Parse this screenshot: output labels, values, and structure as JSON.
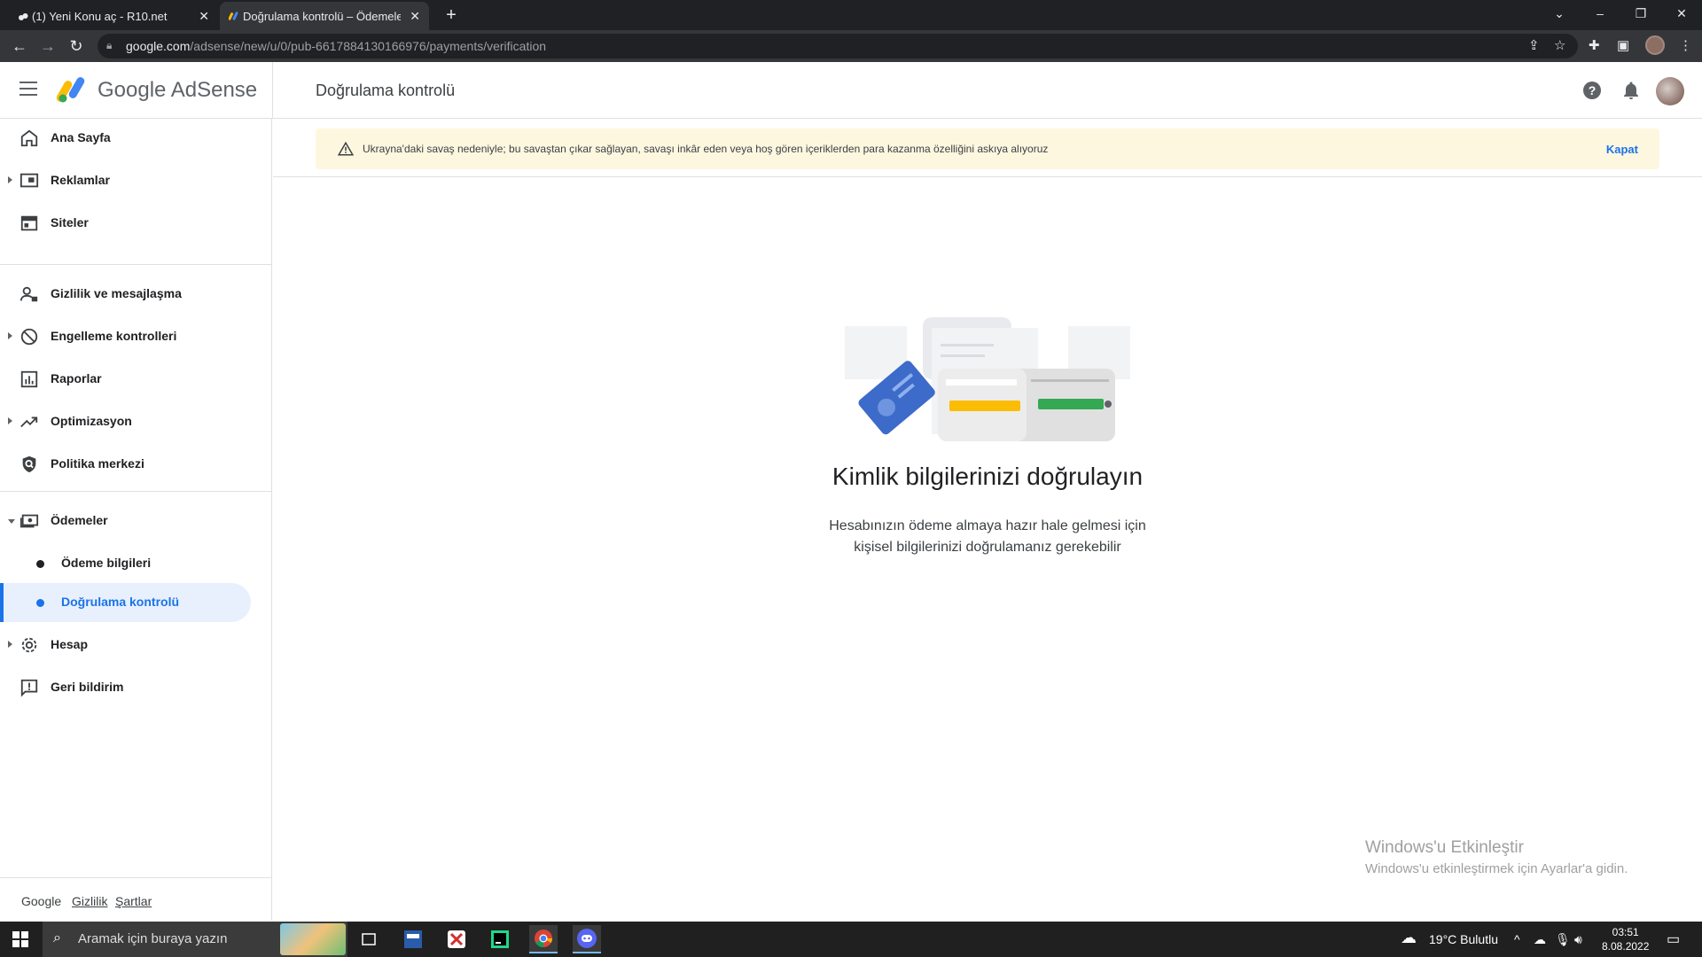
{
  "browser": {
    "tabs": [
      {
        "label": "(1) Yeni Konu aç - R10.net",
        "active": false
      },
      {
        "label": "Doğrulama kontrolü – Ödemeler",
        "active": true
      }
    ],
    "url_host": "google.com",
    "url_path": "/adsense/new/u/0/pub-6617884130166976/payments/verification"
  },
  "header": {
    "logo_text": "Google AdSense",
    "page_title": "Doğrulama kontrolü"
  },
  "sidebar": {
    "items": [
      {
        "label": "Ana Sayfa",
        "icon": "home-icon"
      },
      {
        "label": "Reklamlar",
        "icon": "ads-icon"
      },
      {
        "label": "Siteler",
        "icon": "sites-icon"
      },
      {
        "label": "Gizlilik ve mesajlaşma",
        "icon": "privacy-icon"
      },
      {
        "label": "Engelleme kontrolleri",
        "icon": "block-icon"
      },
      {
        "label": "Raporlar",
        "icon": "reports-icon"
      },
      {
        "label": "Optimizasyon",
        "icon": "optimization-icon"
      },
      {
        "label": "Politika merkezi",
        "icon": "policy-icon"
      },
      {
        "label": "Ödemeler",
        "icon": "payments-icon"
      },
      {
        "label": "Ödeme bilgileri"
      },
      {
        "label": "Doğrulama kontrolü"
      },
      {
        "label": "Hesap",
        "icon": "gear-icon"
      },
      {
        "label": "Geri bildirim",
        "icon": "feedback-icon"
      }
    ],
    "footer": {
      "google": "Google",
      "privacy": "Gizlilik",
      "terms": "Şartlar"
    }
  },
  "banner": {
    "text": "Ukrayna'daki savaş nedeniyle; bu savaştan çıkar sağlayan, savaşı inkâr eden veya hoş gören içeriklerden para kazanma özelliğini askıya alıyoruz",
    "close_label": "Kapat"
  },
  "main": {
    "heading": "Kimlik bilgilerinizi doğrulayın",
    "desc_line1": "Hesabınızın ödeme almaya hazır hale gelmesi için",
    "desc_line2": "kişisel bilgilerinizi doğrulamanız gerekebilir"
  },
  "watermark": {
    "title": "Windows'u Etkinleştir",
    "subtitle": "Windows'u etkinleştirmek için Ayarlar'a gidin."
  },
  "taskbar": {
    "search_placeholder": "Aramak için buraya yazın",
    "weather": "19°C  Bulutlu",
    "time": "03:51",
    "date": "8.08.2022"
  },
  "colors": {
    "accent": "#1a73e8",
    "banner_bg": "#fef7e0",
    "active_nav_bg": "#e8f0fe"
  }
}
